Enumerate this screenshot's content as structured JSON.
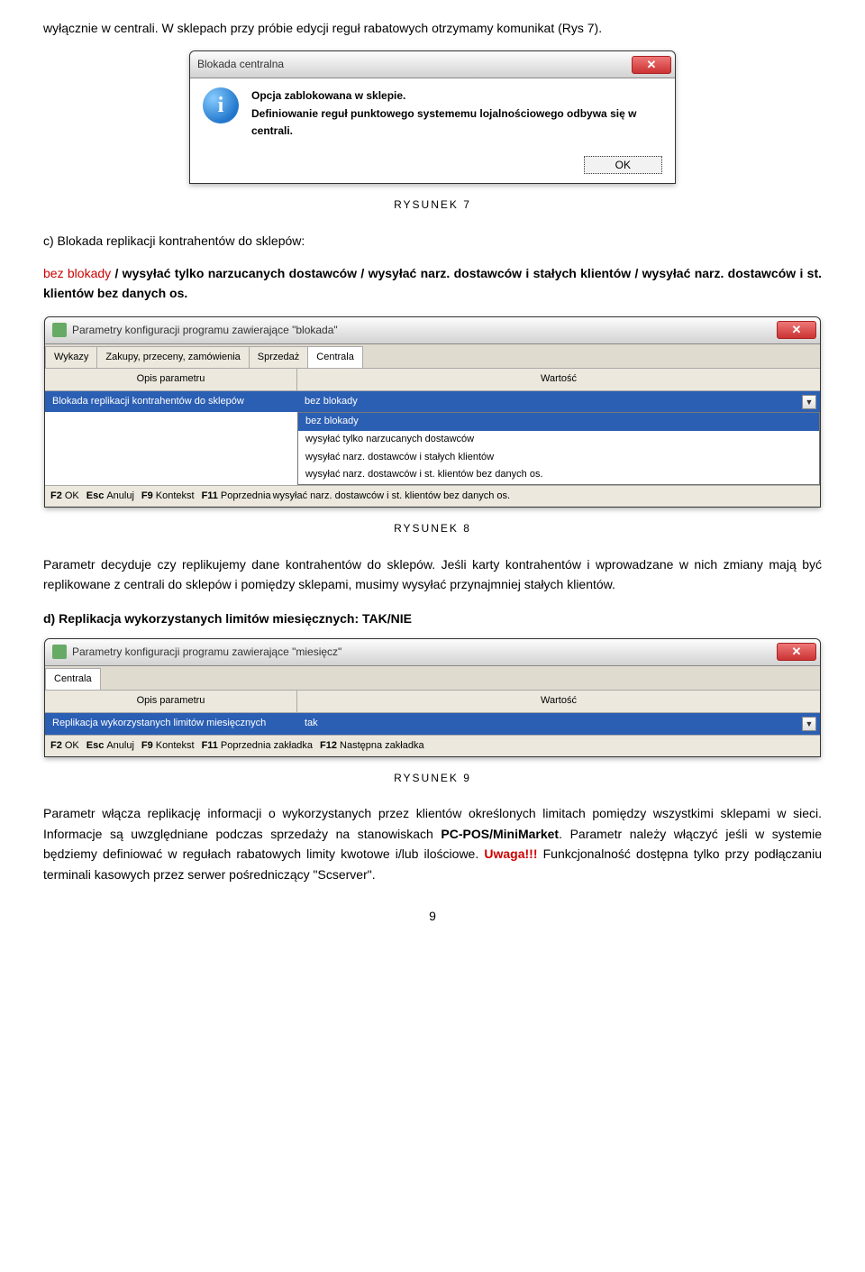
{
  "text": {
    "p1": "wyłącznie w centrali.  W sklepach przy  próbie edycji reguł rabatowych otrzymamy komunikat (Rys 7).",
    "cap7": "RYSUNEK 7",
    "section_c_lead": "c) Blokada replikacji kontrahentów do sklepów:",
    "bez_blokady": "bez blokady",
    "opts_line1_mid": "  /  wysyłać tylko narzucanych dostawców  /  wysyłać narz. dostawców i stałych klientów  /  wysyłać narz. dostawców i st. klientów bez danych os.",
    "cap8": "RYSUNEK 8",
    "p2": "Parametr decyduje czy replikujemy dane kontrahentów do sklepów. Jeśli karty kontrahentów i wprowadzane w nich zmiany mają być replikowane z centrali do sklepów i pomiędzy sklepami, musimy wysyłać przynajmniej stałych klientów.",
    "section_d": "d) Replikacja wykorzystanych limitów miesięcznych: TAK/NIE",
    "cap9": "RYSUNEK 9",
    "p3a": "Parametr włącza replikację  informacji o wykorzystanych przez  klientów określonych limitach pomiędzy  wszystkimi sklepami  w sieci. Informacje są uwzględniane podczas sprzedaży na stanowiskach ",
    "pcpos": "PC-POS/MiniMarket",
    "p3b": ". Parametr należy włączyć  jeśli w systemie będziemy definiować w regułach rabatowych limity kwotowe i/lub ilościowe. ",
    "uwaga": "Uwaga!!!",
    "p3c": " Funkcjonalność dostępna tylko przy podłączaniu terminali kasowych przez serwer pośredniczący \"Scserver\".",
    "page": "9"
  },
  "dlg1": {
    "title": "Blokada centralna",
    "line1": "Opcja zablokowana w sklepie.",
    "line2": "Definiowanie reguł punktowego systememu lojalnościowego odbywa się w centrali.",
    "ok": "OK"
  },
  "dlg2": {
    "title": "Parametry konfiguracji programu zawierające \"blokada\"",
    "tabs": [
      "Wykazy",
      "Zakupy, przeceny, zamówienia",
      "Sprzedaż",
      "Centrala"
    ],
    "hdr1": "Opis parametru",
    "hdr2": "Wartość",
    "row_label": "Blokada replikacji kontrahentów do sklepów",
    "row_value": "bez blokady",
    "options": [
      "bez blokady",
      "wysyłać tylko narzucanych dostawców",
      "wysyłać narz. dostawców i stałych klientów",
      "wysyłać narz. dostawców i st. klientów bez danych os."
    ],
    "status_keys": [
      "F2",
      "Esc",
      "F9",
      "F11"
    ],
    "status_vals": [
      "OK",
      "Anuluj",
      "Kontekst",
      "Poprzednia"
    ]
  },
  "dlg3": {
    "title": "Parametry konfiguracji programu zawierające \"miesięcz\"",
    "tabs": [
      "Centrala"
    ],
    "hdr1": "Opis parametru",
    "hdr2": "Wartość",
    "row_label": "Replikacja wykorzystanych limitów miesięcznych",
    "row_value": "tak",
    "status_keys": [
      "F2",
      "Esc",
      "F9",
      "F11",
      "F12"
    ],
    "status_vals": [
      "OK",
      "Anuluj",
      "Kontekst",
      "Poprzednia zakładka",
      "Następna zakładka"
    ]
  }
}
